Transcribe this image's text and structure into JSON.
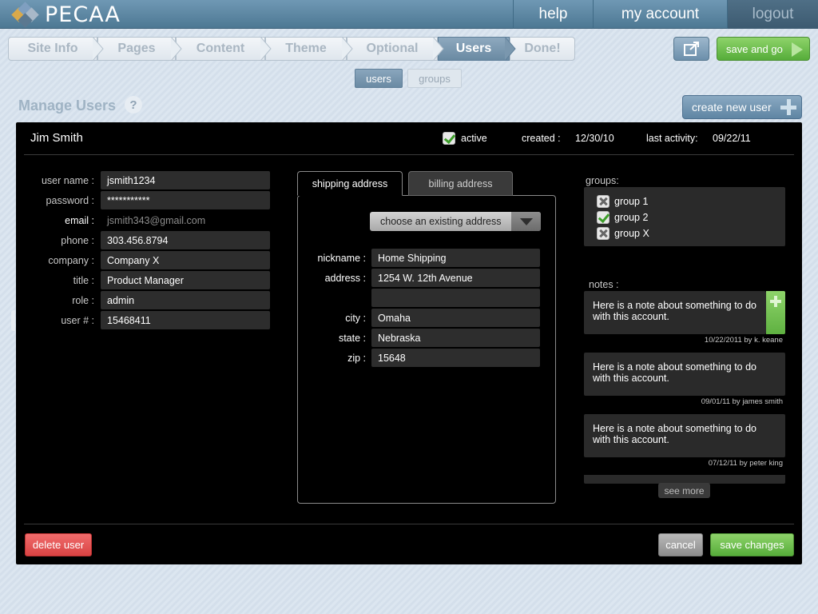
{
  "app": {
    "logo_text": "PECAA",
    "nav": {
      "help": "help",
      "my_account": "my account",
      "logout": "logout"
    }
  },
  "steps": [
    {
      "label": "Site Info"
    },
    {
      "label": "Pages"
    },
    {
      "label": "Content"
    },
    {
      "label": "Theme"
    },
    {
      "label": "Optional"
    },
    {
      "label": "Users",
      "active": true
    },
    {
      "label": "Done!"
    }
  ],
  "toolbar": {
    "save_and_go": "save and go",
    "external_icon": "external-link-icon"
  },
  "subtabs": {
    "users": "users",
    "groups": "groups"
  },
  "page": {
    "title": "Manage Users",
    "help_glyph": "?",
    "create_label": "create new user"
  },
  "user": {
    "full_name": "Jim Smith",
    "active_label": "active",
    "active": true,
    "created_label": "created :",
    "created": "12/30/10",
    "last_activity_label": "last activity:",
    "last_activity": "09/22/11"
  },
  "fields": [
    {
      "label": "user name :",
      "value": "jsmith1234"
    },
    {
      "label": "password :",
      "value": "***********"
    },
    {
      "label": "email :",
      "value": "jsmith343@gmail.com"
    },
    {
      "label": "phone :",
      "value": "303.456.8794"
    },
    {
      "label": "company :",
      "value": "Company X"
    },
    {
      "label": "title :",
      "value": "Product Manager"
    },
    {
      "label": "role :",
      "value": "admin"
    },
    {
      "label": "user # :",
      "value": "15468411"
    }
  ],
  "address": {
    "tab_shipping": "shipping address",
    "tab_billing": "billing address",
    "choose_label": "choose an existing address",
    "nickname_label": "nickname :",
    "nickname": "Home Shipping",
    "address_label": "address :",
    "address1": "1254 W. 12th Avenue",
    "address2": "",
    "city_label": "city :",
    "city": "Omaha",
    "state_label": "state :",
    "state": "Nebraska",
    "zip_label": "zip :",
    "zip": "15648"
  },
  "groups": {
    "label": "groups:",
    "items": [
      {
        "name": "group 1",
        "checked": false
      },
      {
        "name": "group 2",
        "checked": true
      },
      {
        "name": "group X",
        "checked": false
      }
    ]
  },
  "notes": {
    "label": "notes :",
    "items": [
      {
        "text": "Here is a note about something to do with this account.",
        "meta": "10/22/2011 by k. keane"
      },
      {
        "text": "Here is a note about something to do with this account.",
        "meta": "09/01/11 by james smith"
      },
      {
        "text": "Here is a note about something to do with this account.",
        "meta": "07/12/11 by peter king"
      }
    ],
    "see_more": "see more"
  },
  "buttons": {
    "delete": "delete user",
    "cancel": "cancel",
    "save": "save changes"
  },
  "colors": {
    "accent_green": "#56ad3a",
    "danger_red": "#d94343",
    "brand_blue": "#5f85a3"
  }
}
